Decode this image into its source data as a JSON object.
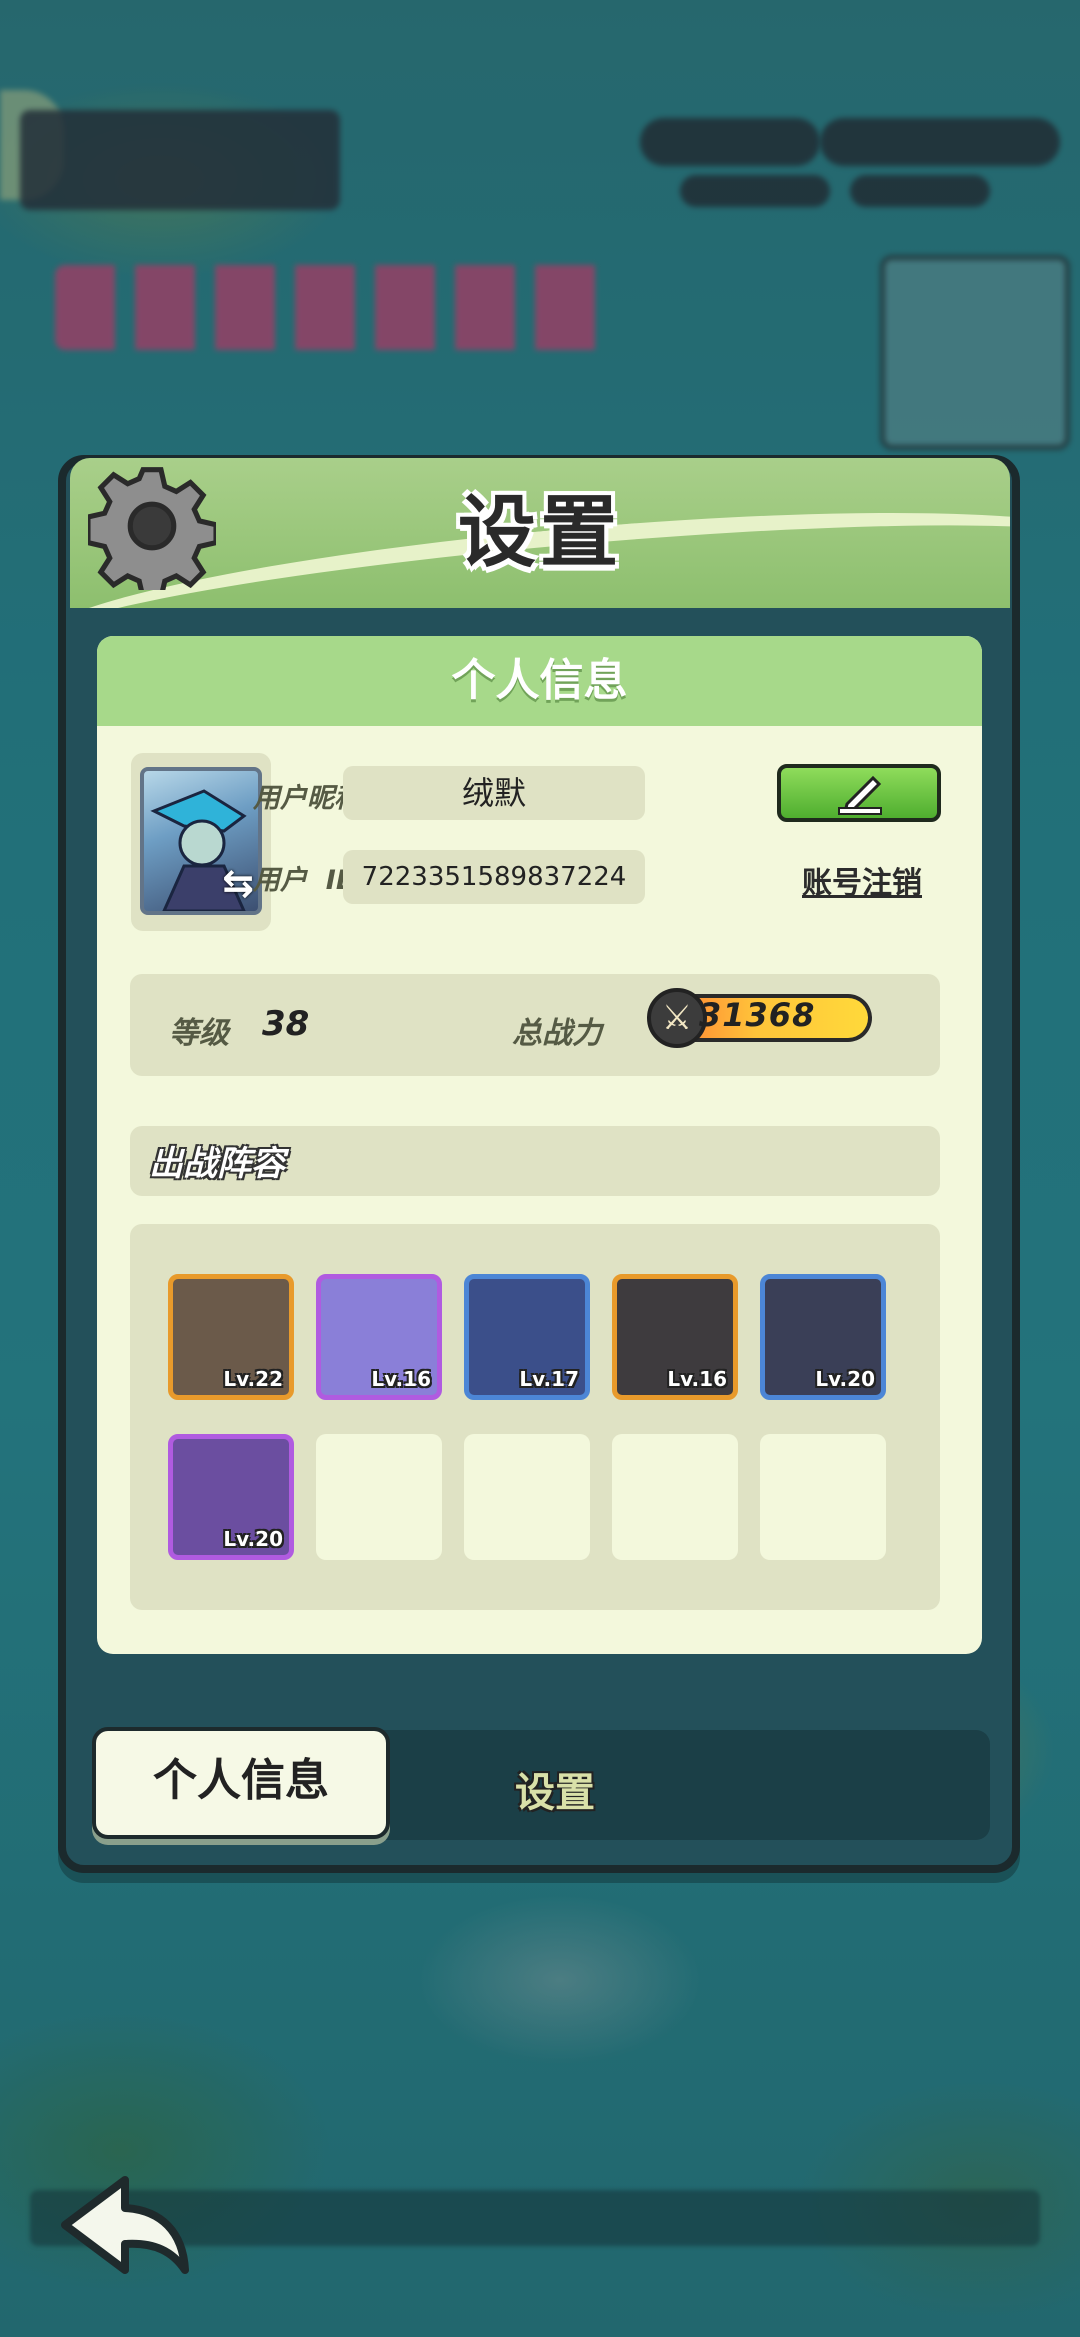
{
  "dialog": {
    "title": "设置",
    "panel_title": "个人信息"
  },
  "profile": {
    "nickname_label": "用户昵称",
    "nickname": "绒默",
    "id_label": "用户  ID",
    "user_id": "7223351589837224",
    "deregister_label": "账号注销",
    "level_label": "等级",
    "level": "38",
    "power_label": "总战力",
    "power": "31368"
  },
  "team": {
    "title": "出战阵容",
    "heroes": [
      {
        "level": "Lv.22",
        "rarity": "orange",
        "color": "#6b5a4a"
      },
      {
        "level": "Lv.16",
        "rarity": "purple",
        "color": "#8a7fd8"
      },
      {
        "level": "Lv.17",
        "rarity": "blue",
        "color": "#3b4f8a"
      },
      {
        "level": "Lv.16",
        "rarity": "orange",
        "color": "#3e3b3e"
      },
      {
        "level": "Lv.20",
        "rarity": "blue",
        "color": "#3a3f57"
      },
      {
        "level": "Lv.20",
        "rarity": "purple",
        "color": "#6b4ea0"
      }
    ],
    "empty_slots": 4
  },
  "tabs": {
    "active": "个人信息",
    "inactive": "设置"
  },
  "colors": {
    "accent_green": "#a7d98a",
    "panel_bg": "#f3f8dc",
    "edit_button": "#5fbc38"
  },
  "icons": [
    "gear-icon",
    "edit-pencil-icon",
    "swap-icon",
    "crossed-swords-icon",
    "back-arrow-icon"
  ]
}
